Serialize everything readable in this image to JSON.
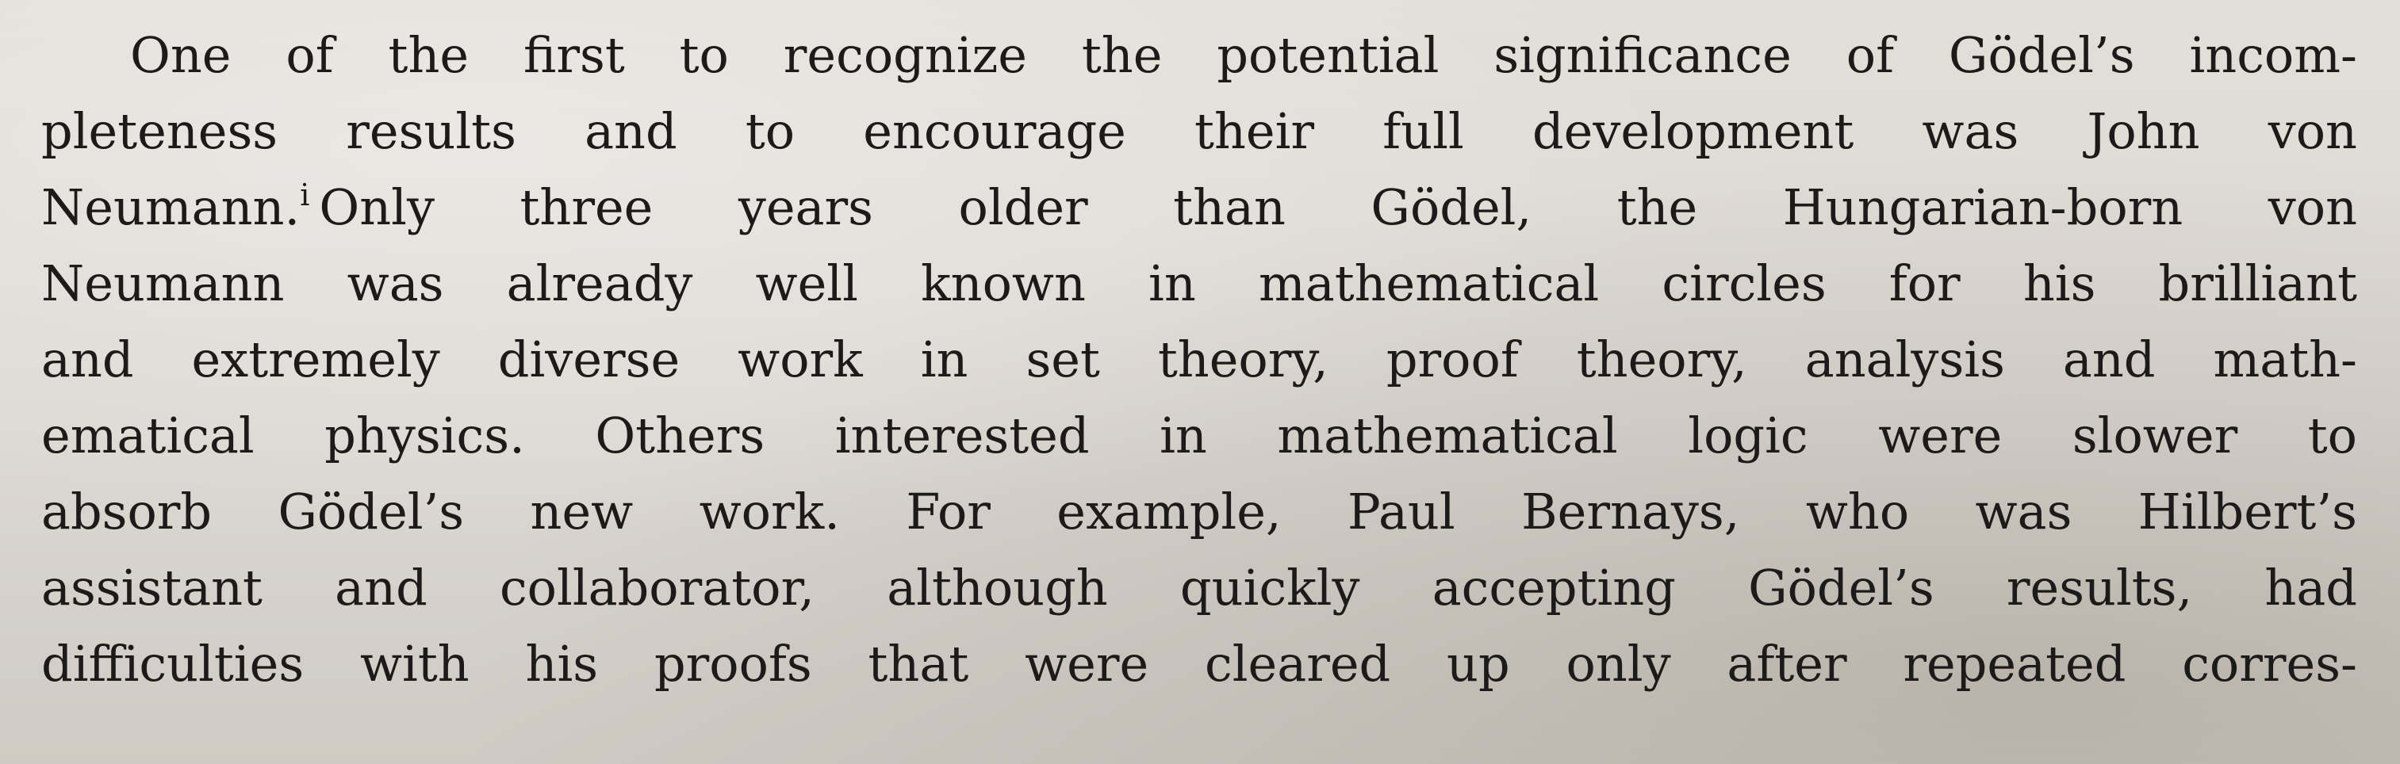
{
  "paragraph": {
    "lines": [
      "One of the first to recognize the potential significance of Gödel’s incom-",
      "pleteness results and to encourage their full development was John von",
      "Neumann.",
      "Only three years older than Gödel, the Hungarian-born von",
      "Neumann was already well known in mathematical circles for his brilliant",
      "and extremely diverse work in set theory, proof theory, analysis and math-",
      "ematical physics. Others interested in mathematical logic were slower to",
      "absorb Gödel’s new work. For example, Paul Bernays, who was Hilbert’s",
      "assistant and collaborator, although quickly accepting Gödel’s results, had",
      "difficulties with his proofs that were cleared up only after repeated corres-"
    ],
    "footnote_mark": "i"
  }
}
